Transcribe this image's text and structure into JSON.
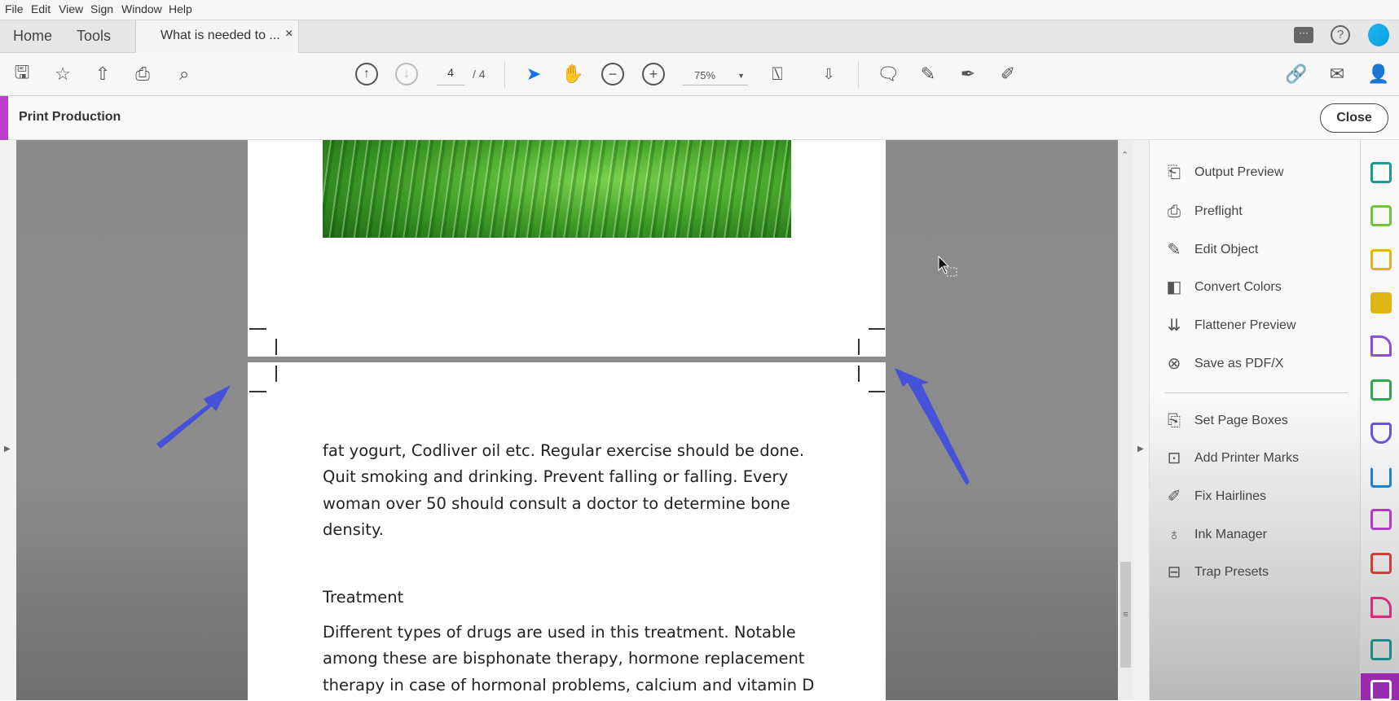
{
  "menu": [
    "File",
    "Edit",
    "View",
    "Sign",
    "Window",
    "Help"
  ],
  "tabs": {
    "home": "Home",
    "tools": "Tools",
    "document": "What is needed to ...",
    "close": "×"
  },
  "toolbar": {
    "page_current": "4",
    "page_total": "/ 4",
    "zoom": "75%"
  },
  "panel_title": "Print Production",
  "close_label": "Close",
  "tools": [
    "Output Preview",
    "Preflight",
    "Edit Object",
    "Convert Colors",
    "Flattener Preview",
    "Save as PDF/X"
  ],
  "tools2": [
    "Set Page Boxes",
    "Add Printer Marks",
    "Fix Hairlines",
    "Ink Manager",
    "Trap Presets"
  ],
  "document": {
    "para1": [
      "fat yogurt, Codliver oil etc. Regular exercise should be done.",
      "Quit smoking and drinking. Prevent falling or falling. Every",
      "woman over 50 should consult a doctor to determine bone",
      "density."
    ],
    "heading": "Treatment",
    "para2": [
      "Different types of drugs are used in this treatment. Notable",
      "among these are bisphonate therapy, hormone replacement",
      "therapy in case of hormonal problems, calcium and vitamin D"
    ]
  },
  "colors": {
    "accent": "#c03ecf",
    "arrow": "#4551d9",
    "cursor_blue": "#1473e6"
  }
}
